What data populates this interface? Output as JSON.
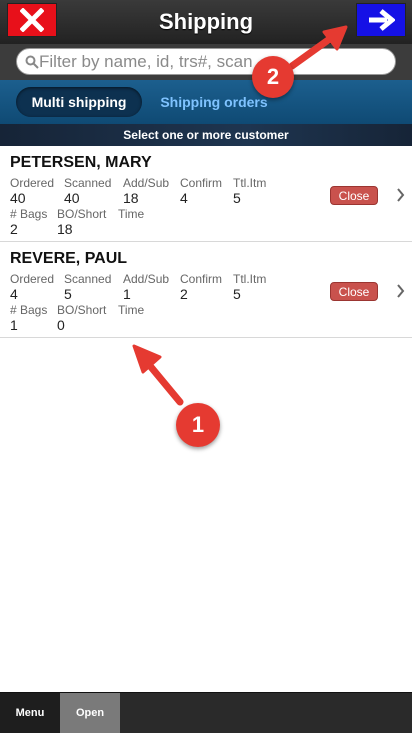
{
  "header": {
    "title": "Shipping",
    "close_icon": "close-x-icon",
    "next_icon": "arrow-right-icon",
    "colors": {
      "close": "#e8101a",
      "next": "#1511e6"
    }
  },
  "search": {
    "placeholder": "Filter by name, id, trs#, scan",
    "value": ""
  },
  "tabs": [
    {
      "label": "Multi shipping",
      "active": true
    },
    {
      "label": "Shipping orders",
      "active": false
    }
  ],
  "subheader": "Select one or more customer",
  "customers": [
    {
      "name": "PETERSEN, MARY",
      "ordered_label": "Ordered",
      "ordered": "40",
      "scanned_label": "Scanned",
      "scanned": "40",
      "addsub_label": "Add/Sub",
      "addsub": "18",
      "confirm_label": "Confirm",
      "confirm": "4",
      "ttl_label": "Ttl.Itm",
      "ttl": "5",
      "bags_label": "# Bags",
      "bags": "2",
      "bo_label": "BO/Short",
      "bo": "18",
      "time_label": "Time",
      "time": "",
      "close_label": "Close"
    },
    {
      "name": "REVERE, PAUL",
      "ordered_label": "Ordered",
      "ordered": "4",
      "scanned_label": "Scanned",
      "scanned": "5",
      "addsub_label": "Add/Sub",
      "addsub": "1",
      "confirm_label": "Confirm",
      "confirm": "2",
      "ttl_label": "Ttl.Itm",
      "ttl": "5",
      "bags_label": "# Bags",
      "bags": "1",
      "bo_label": "BO/Short",
      "bo": "0",
      "time_label": "Time",
      "time": "",
      "close_label": "Close"
    }
  ],
  "footer": {
    "menu_label": "Menu",
    "open_label": "Open"
  },
  "annotations": [
    {
      "label": "1"
    },
    {
      "label": "2"
    }
  ]
}
